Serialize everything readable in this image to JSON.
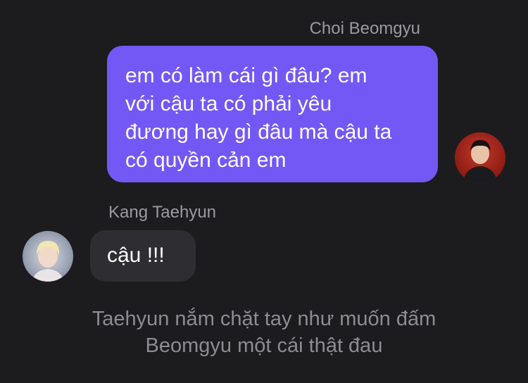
{
  "messages": [
    {
      "sender": "Choi Beomgyu",
      "avatar_icon": "avatar-photo-icon",
      "lines": [
        "em có làm cái gì đâu? em",
        "với cậu ta có phải yêu",
        "đương hay gì đâu mà cậu ta",
        "có quyền cản em"
      ]
    },
    {
      "sender": "Kang Taehyun",
      "avatar_icon": "avatar-photo-icon",
      "lines": [
        "cậu !!!"
      ]
    }
  ],
  "narration": {
    "lines": [
      "Taehyun nắm chặt tay như muốn đấm",
      "Beomgyu một cái thật đau"
    ]
  },
  "colors": {
    "background": "#1c1c1e",
    "outgoing_bubble": "#7358f5",
    "incoming_bubble": "#2e2e32",
    "sender_name": "#9a9aa0",
    "narration": "#8c8c92"
  }
}
